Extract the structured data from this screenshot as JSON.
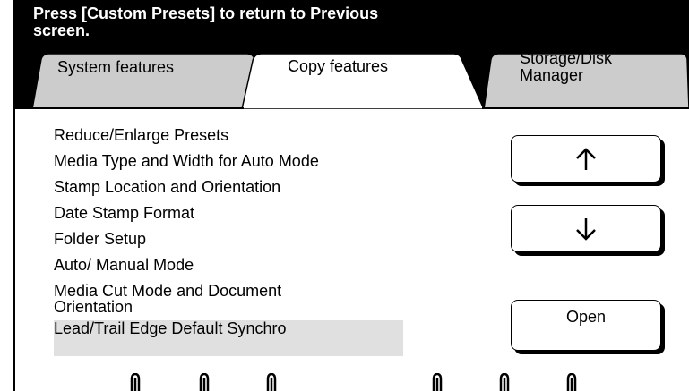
{
  "header": {
    "message": "Press [Custom Presets] to return to Previous screen."
  },
  "tabs": [
    {
      "label": "System features",
      "active": false
    },
    {
      "label": "Copy features",
      "active": true
    },
    {
      "label": "Storage/Disk Manager",
      "active": false
    }
  ],
  "list": {
    "items": [
      "Reduce/Enlarge Presets",
      "Media Type and Width for Auto Mode",
      "Stamp Location and Orientation",
      "Date Stamp Format",
      "Folder Setup",
      "Auto/ Manual Mode",
      "Media Cut Mode and Document Orientation",
      "Lead/Trail Edge Default Synchro"
    ],
    "selected_item": "Lead/Trail Edge Default Synchro"
  },
  "buttons": {
    "up_icon": "arrow-up-icon",
    "down_icon": "arrow-down-icon",
    "open_label": "Open"
  },
  "colors": {
    "header_bg": "#000000",
    "header_text": "#ffffff",
    "tab_inactive": "#cccccc",
    "tab_active": "#ffffff",
    "selected_row": "#e0e0e0"
  }
}
